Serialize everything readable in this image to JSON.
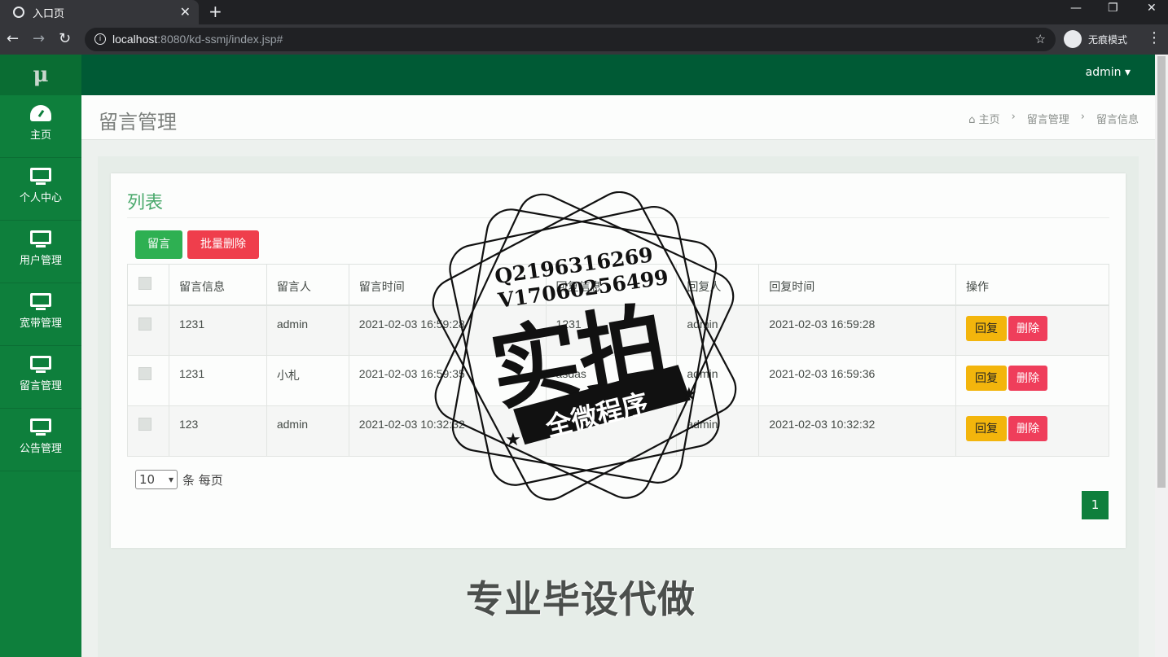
{
  "browser": {
    "tab_title": "入口页",
    "url_host": "localhost",
    "url_rest": ":8080/kd-ssmj/index.jsp#",
    "incognito_label": "无痕模式"
  },
  "sidebar": {
    "brand": "μ",
    "items": [
      {
        "label": "主页",
        "icon": "dashboard-icon"
      },
      {
        "label": "个人中心",
        "icon": "monitor-icon"
      },
      {
        "label": "用户管理",
        "icon": "monitor-icon"
      },
      {
        "label": "宽带管理",
        "icon": "monitor-icon"
      },
      {
        "label": "留言管理",
        "icon": "monitor-icon"
      },
      {
        "label": "公告管理",
        "icon": "monitor-icon"
      }
    ]
  },
  "topbar": {
    "user": "admin"
  },
  "header": {
    "title": "留言管理",
    "breadcrumb": [
      "主页",
      "留言管理",
      "留言信息"
    ]
  },
  "card": {
    "title": "列表",
    "add_button": "留言",
    "batch_delete_button": "批量删除",
    "columns": [
      "留言信息",
      "留言人",
      "留言时间",
      "回复信息",
      "回复人",
      "回复时间",
      "操作"
    ],
    "rows": [
      {
        "message": "1231",
        "author": "admin",
        "time": "2021-02-03 16:59:28",
        "reply": "1231",
        "replier": "admin",
        "reply_time": "2021-02-03 16:59:28"
      },
      {
        "message": "1231",
        "author": "小札",
        "time": "2021-02-03 16:59:35",
        "reply": "asdas",
        "replier": "admin",
        "reply_time": "2021-02-03 16:59:36"
      },
      {
        "message": "123",
        "author": "admin",
        "time": "2021-02-03 10:32:32",
        "reply": "",
        "replier": "admin",
        "reply_time": "2021-02-03 10:32:32"
      }
    ],
    "reply_button": "回复",
    "delete_button": "删除",
    "page_size": "10",
    "page_size_suffix": "条 每页",
    "current_page": "1"
  },
  "watermark": {
    "contact_q": "Q2196316269",
    "contact_v": "V17060256499",
    "main": "实拍",
    "banner": "全微程序",
    "bottom": "专业毕设代做"
  }
}
